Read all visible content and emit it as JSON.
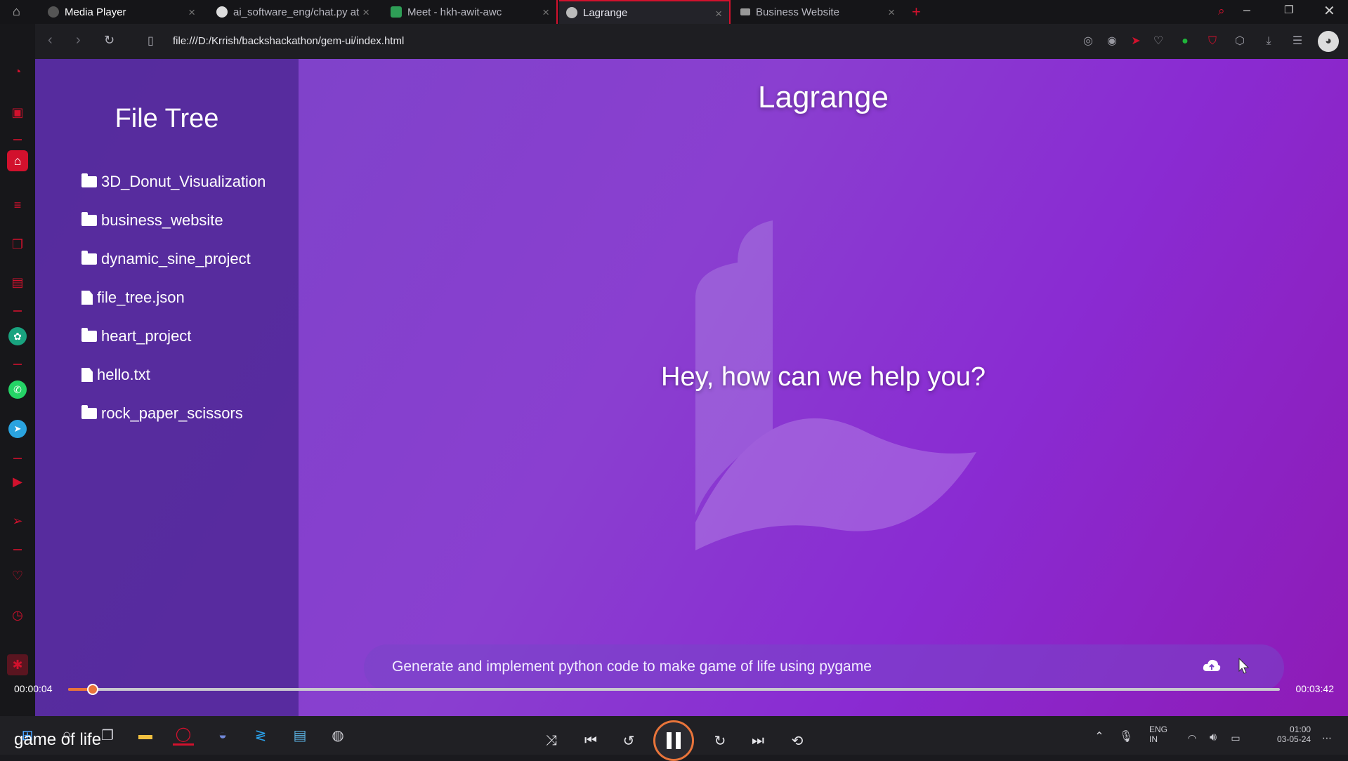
{
  "tabs": [
    {
      "label": "Media Player",
      "icon": "play-icon"
    },
    {
      "label": "ai_software_eng/chat.py at",
      "icon": "github-icon"
    },
    {
      "label": "Meet - hkh-awit-awc",
      "icon": "meet-icon"
    },
    {
      "label": "Lagrange",
      "icon": "globe-icon"
    },
    {
      "label": "Business Website",
      "icon": "crown-icon"
    }
  ],
  "address_bar": {
    "url": "file:///D:/Krrish/backshackathon/gem-ui/index.html"
  },
  "file_tree": {
    "title": "File Tree",
    "items": [
      {
        "name": "3D_Donut_Visualization",
        "type": "folder"
      },
      {
        "name": "business_website",
        "type": "folder"
      },
      {
        "name": "dynamic_sine_project",
        "type": "folder"
      },
      {
        "name": "file_tree.json",
        "type": "file"
      },
      {
        "name": "heart_project",
        "type": "folder"
      },
      {
        "name": "hello.txt",
        "type": "file"
      },
      {
        "name": "rock_paper_scissors",
        "type": "folder"
      }
    ]
  },
  "main": {
    "title": "Lagrange",
    "greeting": "Hey, how can we help you?",
    "prompt": "Generate and implement python code to make game of life using pygame"
  },
  "media_player": {
    "title": "game of life",
    "current_time": "00:00:04",
    "total_time": "00:03:42",
    "progress_fraction": 0.02
  },
  "system_tray": {
    "language": "ENG",
    "region": "IN",
    "time": "01:00",
    "date": "03-05-24"
  },
  "colors": {
    "accent": "#e8743a",
    "opera_red": "#d2112d",
    "page_purple": "#8a3fd0"
  }
}
